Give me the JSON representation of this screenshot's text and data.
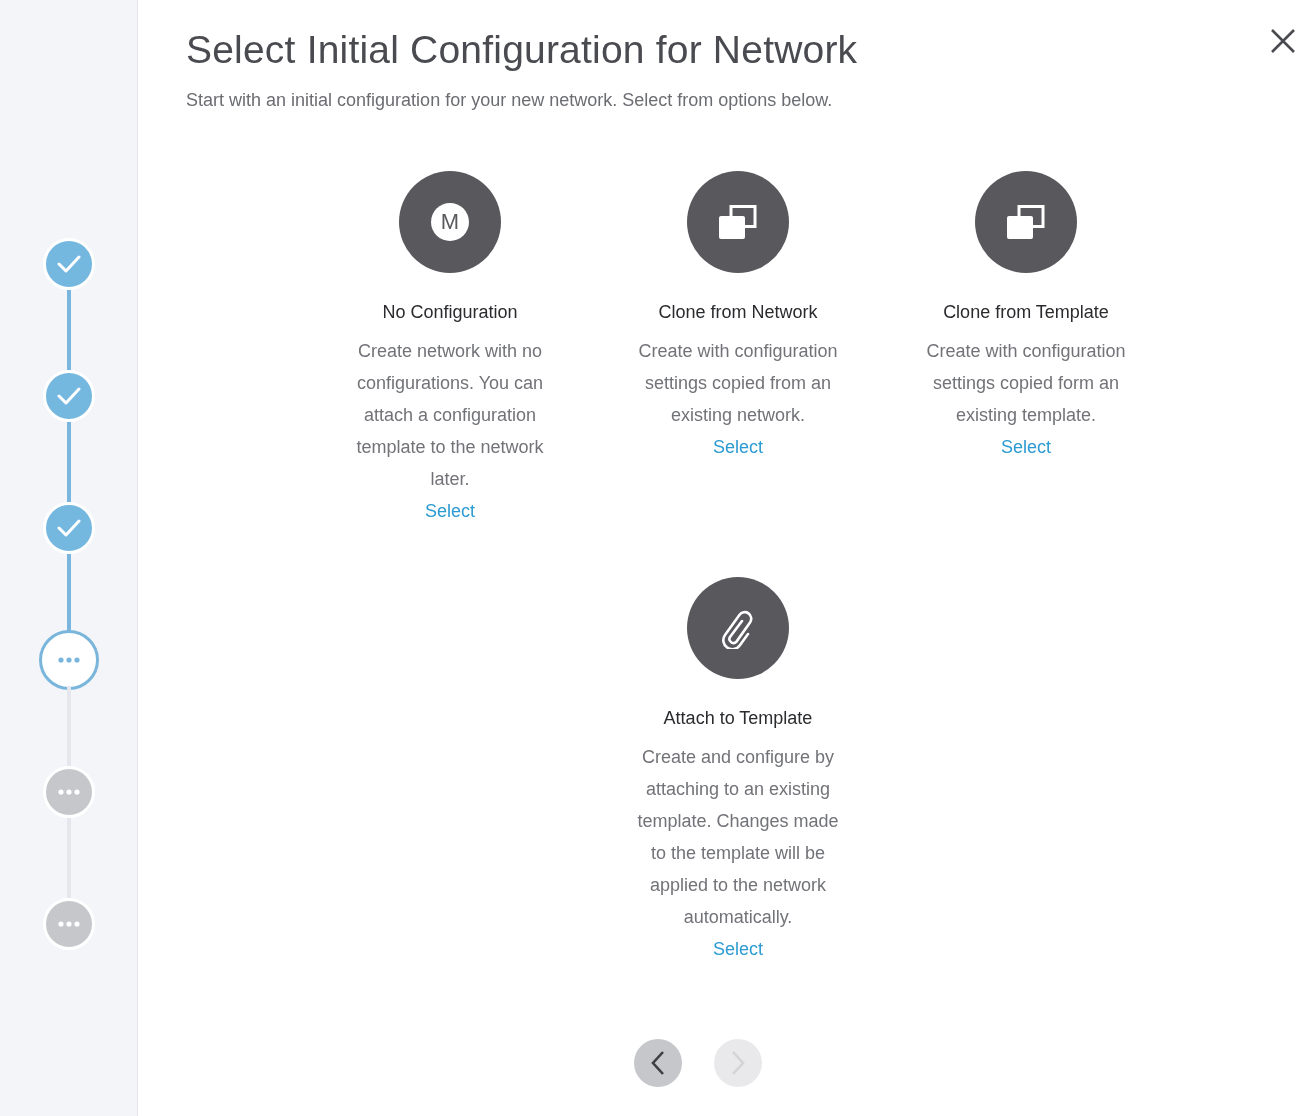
{
  "steps": [
    {
      "completed": true,
      "current": false
    },
    {
      "completed": true,
      "current": false
    },
    {
      "completed": true,
      "current": false
    },
    {
      "completed": false,
      "current": true
    },
    {
      "completed": false,
      "current": false
    },
    {
      "completed": false,
      "current": false
    }
  ],
  "title": "Select Initial Configuration for Network",
  "subtitle": "Start with an initial configuration for your new network. Select from options below.",
  "option_rows": [
    [
      {
        "kind": "letter",
        "letter": "M",
        "title": "No Configuration",
        "description": "Create network with no configurations. You can attach a configuration template to the network later.",
        "action": "Select"
      },
      {
        "kind": "clone",
        "title": "Clone from Network",
        "description": "Create with configuration settings copied from an existing network.",
        "action": "Select"
      },
      {
        "kind": "clone",
        "title": "Clone from Template",
        "description": "Create with configuration settings copied form an existing template.",
        "action": "Select"
      }
    ],
    [
      {
        "kind": "clip",
        "title": "Attach to Template",
        "description": "Create and configure by attaching to an existing template. Changes made to the template will be applied to the network automatically.",
        "action": "Select"
      }
    ]
  ],
  "nav": [
    {
      "kind": "prev",
      "disabled": false
    },
    {
      "kind": "next",
      "disabled": true
    }
  ]
}
